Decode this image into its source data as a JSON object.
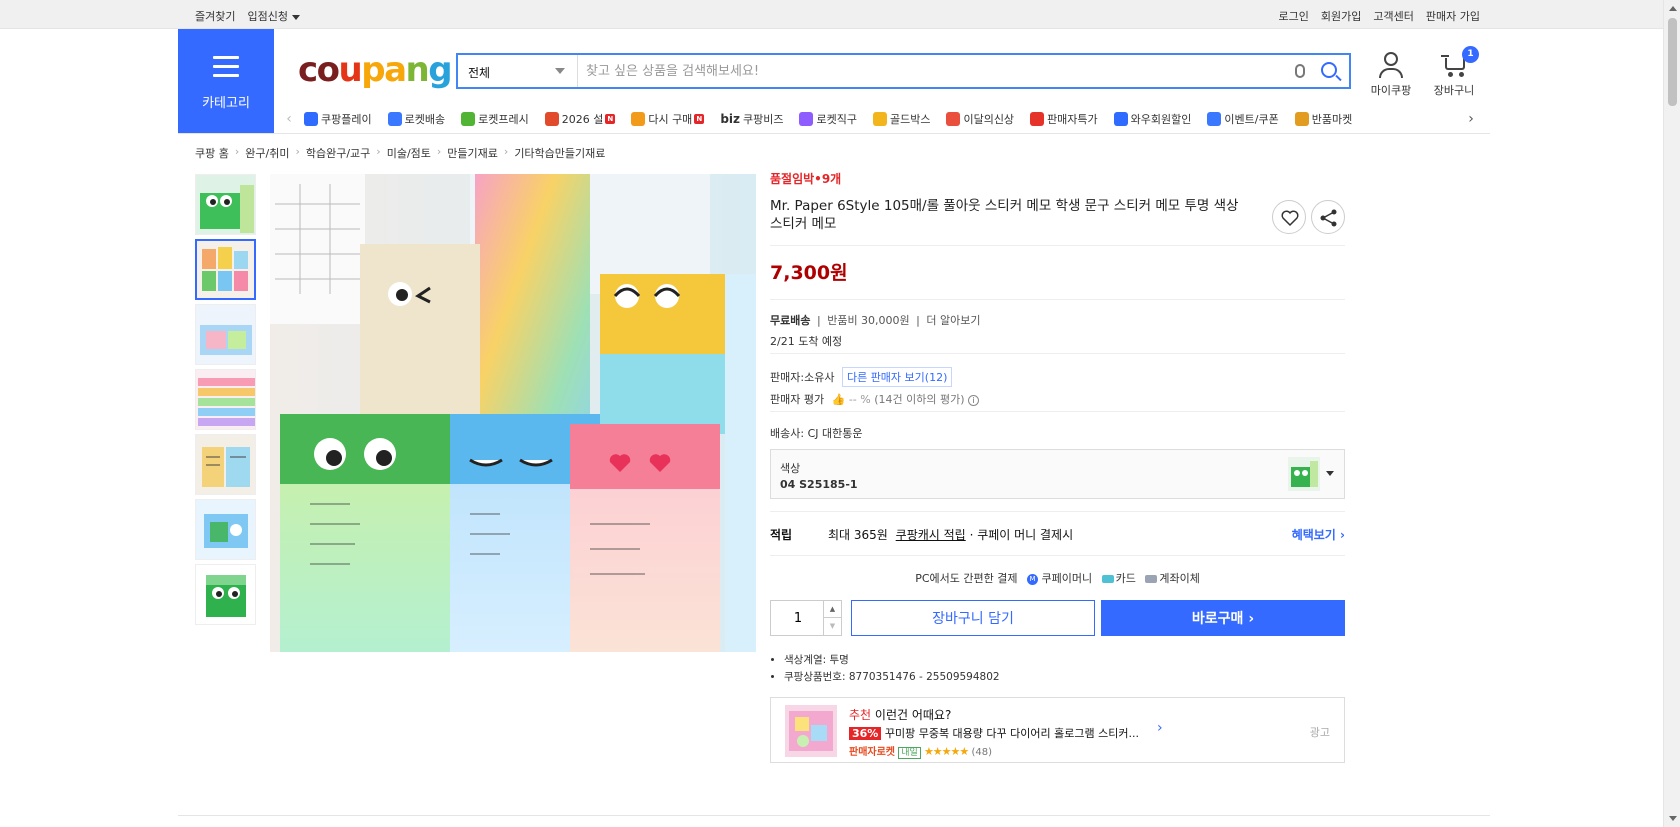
{
  "topbar": {
    "left": [
      "즐겨찾기",
      "입점신청"
    ],
    "right": [
      "로그인",
      "회원가입",
      "고객센터",
      "판매자 가입"
    ]
  },
  "header": {
    "category_label": "카테고리",
    "logo": [
      "c",
      "o",
      "u",
      "p",
      "a",
      "n",
      "g"
    ],
    "search_scope": "전체",
    "search_placeholder": "찾고 싶은 상품을 검색해보세요!",
    "mypage_label": "마이쿠팡",
    "cart_label": "장바구니",
    "cart_count": "1"
  },
  "nav": [
    {
      "label": "쿠팡플레이",
      "icon": "play-icon",
      "color": "#2f6bff"
    },
    {
      "label": "로켓배송",
      "icon": "rocket-icon",
      "color": "#3a79ff"
    },
    {
      "label": "로켓프레시",
      "icon": "rocket-fresh-icon",
      "color": "#52b435"
    },
    {
      "label": "2026 설",
      "icon": "gift-icon",
      "color": "#e14a2a",
      "badge": "N"
    },
    {
      "label": "다시 구매",
      "icon": "house-icon",
      "color": "#f29a19",
      "badge": "N"
    },
    {
      "label": "쿠팡비즈",
      "icon": "biz-icon",
      "color": "#333333",
      "prefix": "biz"
    },
    {
      "label": "로켓직구",
      "icon": "globe-icon",
      "color": "#8f5cff"
    },
    {
      "label": "골드박스",
      "icon": "goldbox-icon",
      "color": "#f2b51c"
    },
    {
      "label": "이달의신상",
      "icon": "bag-icon",
      "color": "#ea4e3d"
    },
    {
      "label": "판매자특가",
      "icon": "percent-icon",
      "color": "#e5332a"
    },
    {
      "label": "와우회원할인",
      "icon": "wow-icon",
      "color": "#2f6bff"
    },
    {
      "label": "이벤트/쿠폰",
      "icon": "coupon-icon",
      "color": "#3a79ff"
    },
    {
      "label": "반품마켓",
      "icon": "market-icon",
      "color": "#e29c1f"
    }
  ],
  "breadcrumb": [
    "쿠팡 홈",
    "완구/취미",
    "학습완구/교구",
    "미술/점토",
    "만들기재료",
    "기타학습만들기재료"
  ],
  "product": {
    "urgency": "품절임박•9개",
    "title": "Mr. Paper 6Style 105매/롤 풀아웃 스티커 메모 학생 문구 스티커 메모 투명 색상 스티커 메모",
    "price": "7,300원",
    "shipping_free": "무료배송",
    "return_fee": "반품비 30,000원",
    "learn_more": "더 알아보기",
    "arrival": "2/21 도착 예정",
    "seller_label": "판매자:",
    "seller_name": "소유사",
    "other_sellers": "다른 판매자 보기(12)",
    "seller_rating_label": "판매자 평가",
    "seller_rating_value": "-- %",
    "seller_rating_note": "(14건 이하의 평가)",
    "carrier_label": "배송사:",
    "carrier_name": "CJ 대한통운",
    "option_label": "색상",
    "option_value": "04 S25185-1",
    "cash_label": "적립",
    "cash_max": "최대 365원",
    "cash_link": "쿠팡캐시 적립",
    "cash_tail": "· 쿠페이 머니 결제시",
    "benefit_link": "혜택보기",
    "pay_intro": "PC에서도 간편한 결제",
    "pay_methods": [
      "쿠페이머니",
      "카드",
      "계좌이체"
    ],
    "quantity": "1",
    "add_to_cart": "장바구니 담기",
    "buy_now": "바로구매",
    "specs": [
      "색상계열: 투명",
      "쿠팡상품번호: 8770351476 - 25509594802"
    ]
  },
  "recommendation": {
    "prefix": "추천",
    "heading": "이런건 어때요?",
    "discount": "36%",
    "name": "꾸미팡 무중복 대용량 다꾸 다이어리 홀로그램 스티커...",
    "badge_text": "판매자로켓",
    "badge_day": "내일",
    "stars": "★★★★★",
    "rating": 5,
    "reviews": "(48)",
    "ad": "광고"
  },
  "colors": {
    "accent": "#346aff",
    "price": "#ae0000",
    "urgent": "#e52528"
  }
}
